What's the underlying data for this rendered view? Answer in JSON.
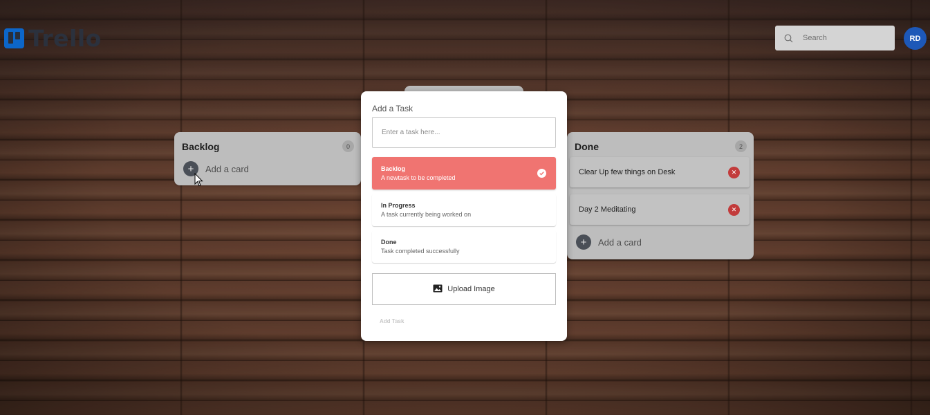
{
  "app": {
    "name": "Trello"
  },
  "header": {
    "search_placeholder": "Search",
    "avatar_initials": "RD",
    "avatar_color": "#1d58b8"
  },
  "lists": {
    "backlog": {
      "title": "Backlog",
      "count": "0",
      "add_label": "Add a card"
    },
    "done": {
      "title": "Done",
      "count": "2",
      "cards": [
        {
          "text": "Clear Up few things on Desk"
        },
        {
          "text": "Day 2 Meditating"
        }
      ],
      "add_label": "Add a card"
    }
  },
  "modal": {
    "title": "Add a Task",
    "input_placeholder": "Enter a task here...",
    "options": [
      {
        "name": "Backlog",
        "desc": "A newtask to be completed",
        "selected": true
      },
      {
        "name": "In Progress",
        "desc": "A task currently being worked on",
        "selected": false
      },
      {
        "name": "Done",
        "desc": "Task completed successfully",
        "selected": false
      }
    ],
    "upload_label": "Upload Image",
    "submit_label": "Add Task",
    "accent_color": "#f07471"
  }
}
